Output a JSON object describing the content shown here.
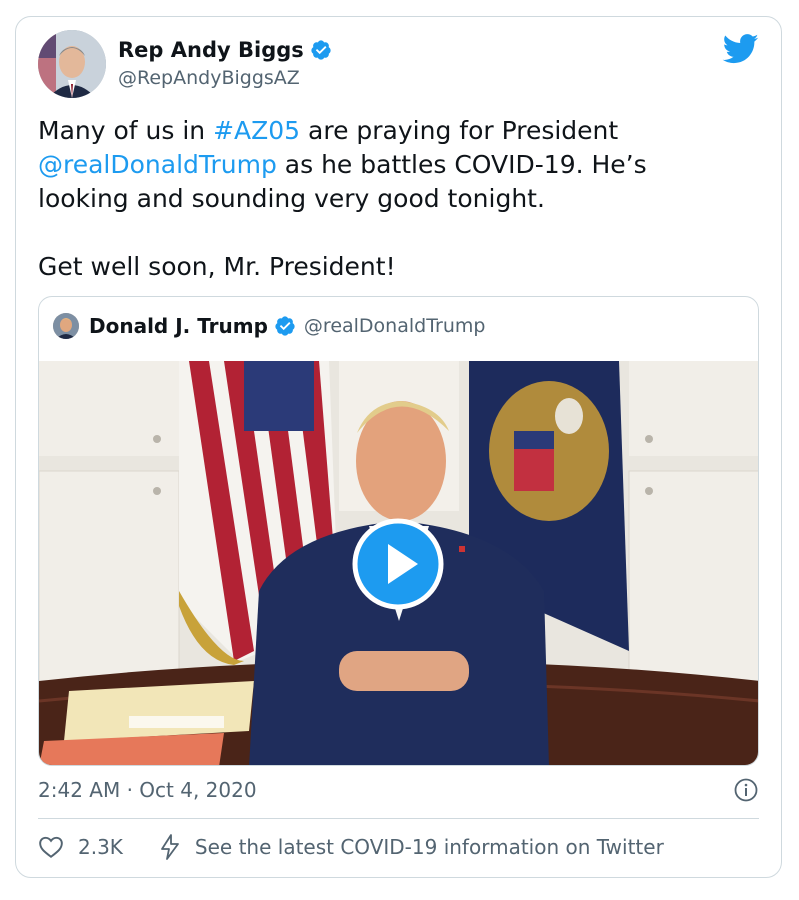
{
  "author": {
    "name": "Rep Andy Biggs",
    "handle": "@RepAndyBiggsAZ",
    "avatar_icon": "profile-photo-avatar"
  },
  "tweet": {
    "line1_pre": "Many of us in ",
    "hashtag": "#AZ05",
    "line1_post": " are praying for President",
    "mention": "@realDonaldTrump",
    "line2_post": " as he battles COVID-19. He’s",
    "line3": "looking and sounding very good tonight.",
    "paragraph2": "Get well soon, Mr. President!"
  },
  "quoted": {
    "name": "Donald J. Trump",
    "handle": "@realDonaldTrump",
    "media": "video-thumbnail"
  },
  "timestamp": "2:42 AM · Oct 4, 2020",
  "actions": {
    "likes": "2.3K",
    "covid_link": "See the latest COVID-19 information on Twitter"
  },
  "colors": {
    "accent": "#1d9bf0",
    "text": "#0f1419",
    "secondary": "#536471",
    "border": "#cfd9de"
  }
}
